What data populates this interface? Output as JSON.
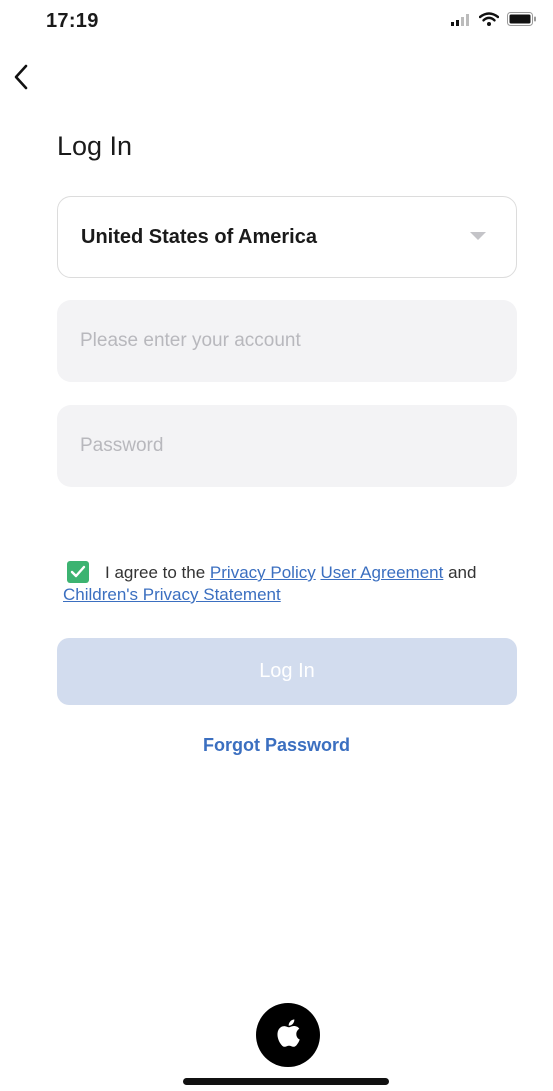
{
  "status_bar": {
    "time": "17:19"
  },
  "header": {
    "title": "Log In"
  },
  "form": {
    "country": "United States of America",
    "account_placeholder": "Please enter your account",
    "password_placeholder": "Password"
  },
  "agreement": {
    "prefix": "I agree to the",
    "privacy_policy": "Privacy Policy",
    "user_agreement_1": "User",
    "user_agreement_2": "Agreement",
    "and": "and",
    "children_privacy": "Children's Privacy Statement",
    "checked": true
  },
  "actions": {
    "login_label": "Log In",
    "forgot_password": "Forgot Password"
  },
  "icons": {
    "back": "chevron-left-icon",
    "dropdown": "caret-down-icon",
    "apple": "apple-icon"
  },
  "colors": {
    "accent": "#3b6fc0",
    "checkbox": "#3cb371",
    "login_disabled": "#d2dcee"
  }
}
